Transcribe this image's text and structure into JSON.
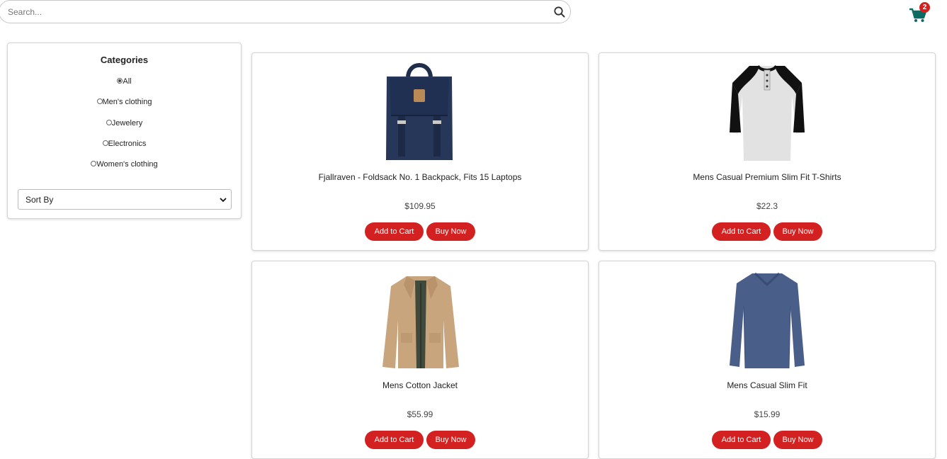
{
  "search": {
    "placeholder": "Search..."
  },
  "cart": {
    "count": "2",
    "icon": "shopping-cart-icon",
    "color": "#0b6b63"
  },
  "sidebar": {
    "title": "Categories",
    "categories": [
      {
        "label": "All",
        "checked": true
      },
      {
        "label": "Men's clothing",
        "checked": false
      },
      {
        "label": "Jewelery",
        "checked": false
      },
      {
        "label": "Electronics",
        "checked": false
      },
      {
        "label": "Women's clothing",
        "checked": false
      }
    ],
    "sort_label": "Sort By"
  },
  "products": [
    {
      "title": "Fjallraven - Foldsack No. 1 Backpack, Fits 15 Laptops",
      "price": "$109.95",
      "add_label": "Add to Cart",
      "buy_label": "Buy Now"
    },
    {
      "title": "Mens Casual Premium Slim Fit T-Shirts",
      "price": "$22.3",
      "add_label": "Add to Cart",
      "buy_label": "Buy Now"
    },
    {
      "title": "Mens Cotton Jacket",
      "price": "$55.99",
      "add_label": "Add to Cart",
      "buy_label": "Buy Now"
    },
    {
      "title": "Mens Casual Slim Fit",
      "price": "$15.99",
      "add_label": "Add to Cart",
      "buy_label": "Buy Now"
    }
  ],
  "colors": {
    "accent": "#d32121",
    "cart": "#0b6b63"
  }
}
